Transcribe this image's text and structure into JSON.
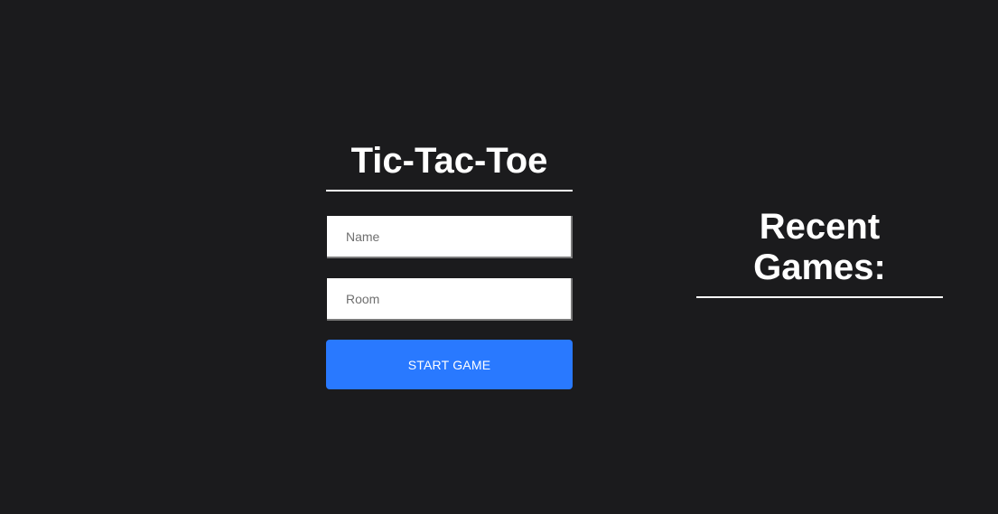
{
  "app": {
    "title": "Tic-Tac-Toe"
  },
  "form": {
    "name_placeholder": "Name",
    "room_placeholder": "Room",
    "start_label": "START GAME"
  },
  "recent": {
    "title_line1": "Recent",
    "title_line2": "Games:",
    "games": []
  },
  "colors": {
    "background": "#1b1b1d",
    "accent": "#2979ff",
    "text": "#ffffff"
  }
}
